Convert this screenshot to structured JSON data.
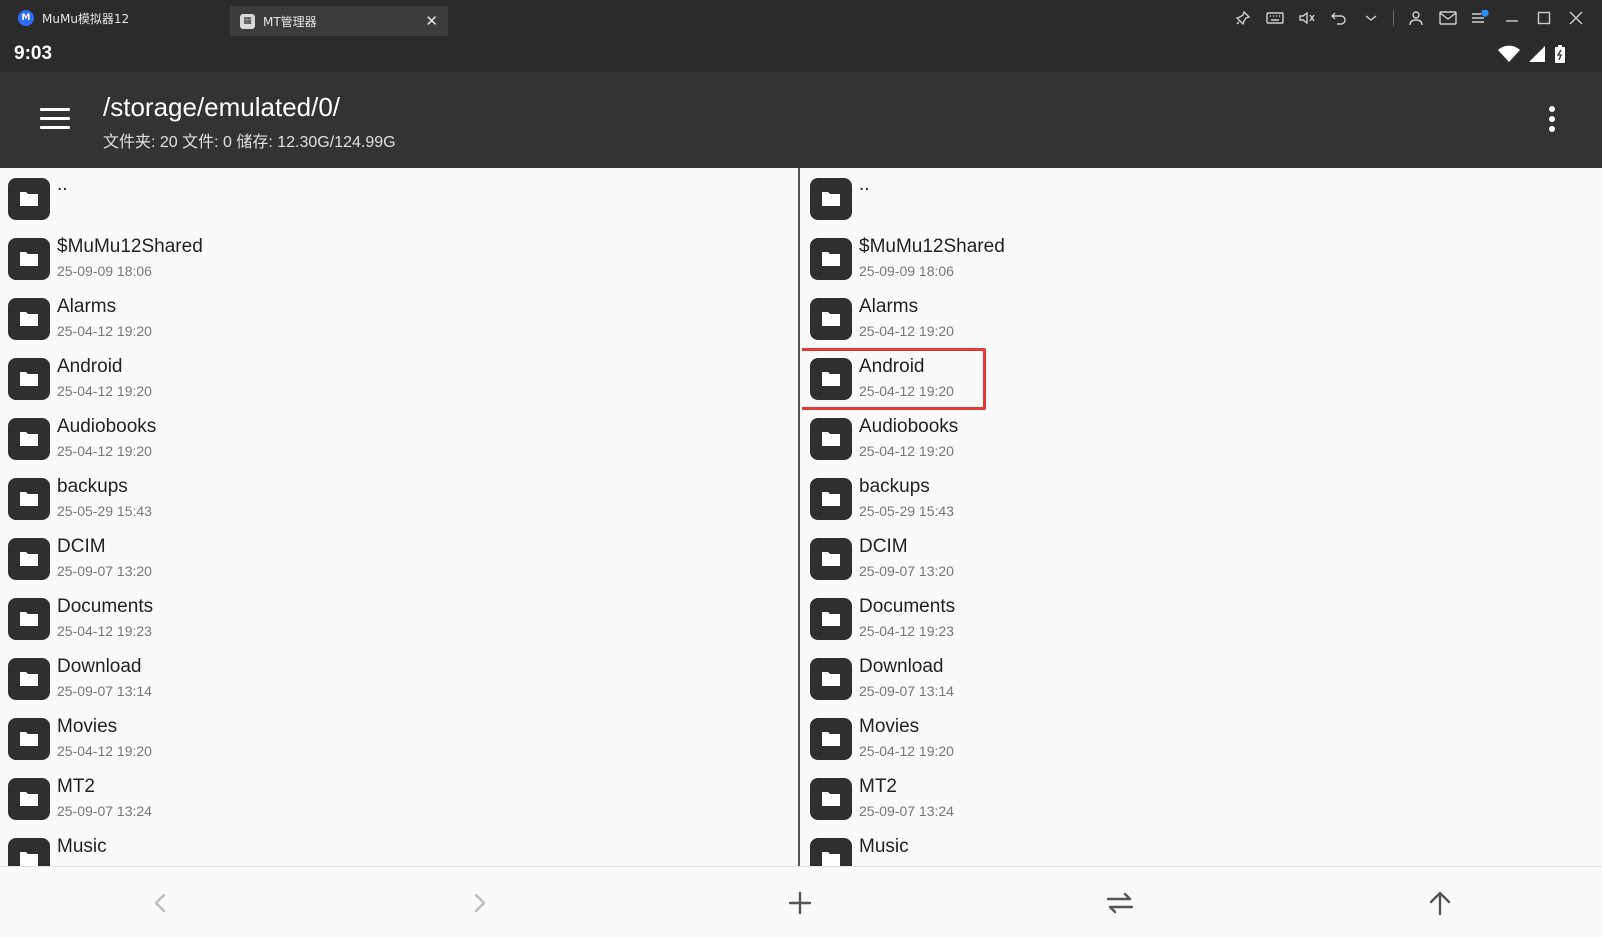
{
  "window": {
    "tabs": [
      {
        "label": "MuMu模拟器12",
        "icon": "mumu-logo-icon"
      },
      {
        "label": "MT管理器",
        "icon": "mt-app-icon",
        "active": true
      }
    ],
    "toolbar_icons": [
      "pin-icon",
      "keyboard-icon",
      "mute-icon",
      "undo-icon",
      "chevron-down-icon",
      "user-icon",
      "mail-icon",
      "notification-menu-icon",
      "minimize-icon",
      "maximize-icon",
      "close-icon"
    ]
  },
  "status": {
    "time": "9:03",
    "icons": [
      "wifi-icon",
      "signal-icon",
      "battery-icon"
    ]
  },
  "appbar": {
    "path": "/storage/emulated/0/",
    "summary": "文件夹: 20  文件: 0  储存: 12.30G/124.99G"
  },
  "left_pane": {
    "items": [
      {
        "name": "..",
        "date": ""
      },
      {
        "name": "$MuMu12Shared",
        "date": "25-09-09 18:06"
      },
      {
        "name": "Alarms",
        "date": "25-04-12 19:20"
      },
      {
        "name": "Android",
        "date": "25-04-12 19:20"
      },
      {
        "name": "Audiobooks",
        "date": "25-04-12 19:20"
      },
      {
        "name": "backups",
        "date": "25-05-29 15:43"
      },
      {
        "name": "DCIM",
        "date": "25-09-07 13:20"
      },
      {
        "name": "Documents",
        "date": "25-04-12 19:23"
      },
      {
        "name": "Download",
        "date": "25-09-07 13:14"
      },
      {
        "name": "Movies",
        "date": "25-04-12 19:20"
      },
      {
        "name": "MT2",
        "date": "25-09-07 13:24"
      },
      {
        "name": "Music",
        "date": ""
      }
    ]
  },
  "right_pane": {
    "highlighted": "Android",
    "items": [
      {
        "name": "..",
        "date": ""
      },
      {
        "name": "$MuMu12Shared",
        "date": "25-09-09 18:06"
      },
      {
        "name": "Alarms",
        "date": "25-04-12 19:20"
      },
      {
        "name": "Android",
        "date": "25-04-12 19:20"
      },
      {
        "name": "Audiobooks",
        "date": "25-04-12 19:20"
      },
      {
        "name": "backups",
        "date": "25-05-29 15:43"
      },
      {
        "name": "DCIM",
        "date": "25-09-07 13:20"
      },
      {
        "name": "Documents",
        "date": "25-04-12 19:23"
      },
      {
        "name": "Download",
        "date": "25-09-07 13:14"
      },
      {
        "name": "Movies",
        "date": "25-04-12 19:20"
      },
      {
        "name": "MT2",
        "date": "25-09-07 13:24"
      },
      {
        "name": "Music",
        "date": ""
      }
    ]
  },
  "bottom_bar": [
    "back-arrow-icon",
    "forward-arrow-icon",
    "add-icon",
    "swap-panes-icon",
    "up-arrow-icon"
  ]
}
